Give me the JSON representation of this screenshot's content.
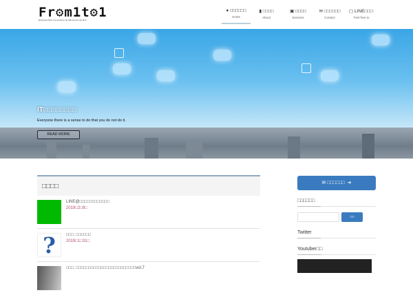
{
  "header": {
    "logo_text": "Fr⚙m1t⚙1",
    "logo_tagline": "Everyone there is a sense to do that you do not do it.",
    "nav": [
      {
        "label": "□□□□□□",
        "sub": "Home",
        "icon": "home-icon",
        "glyph": "●"
      },
      {
        "label": "□□□□",
        "sub": "About",
        "icon": "book-icon",
        "glyph": "▮"
      },
      {
        "label": "□□□□",
        "sub": "Services",
        "icon": "image-icon",
        "glyph": "▣"
      },
      {
        "label": "□□□□□□",
        "sub": "Contact",
        "icon": "envelope-icon",
        "glyph": "✉"
      },
      {
        "label": "LINE□□□:",
        "sub": "Feel free to",
        "icon": "chat-icon",
        "glyph": "▢"
      }
    ]
  },
  "hero": {
    "title": "IT□□□□□□□□",
    "subtitle": "Everyone there is a sense to do that you do not do it.",
    "button": "READ MORE"
  },
  "news": {
    "heading": "□□□□",
    "posts": [
      {
        "title": "LINE@□□□□□□□□□□□□",
        "date": "2019□2□8□",
        "thumb_color": "#00b900"
      },
      {
        "title": "□□□: □□□□□□",
        "date": "2019□1□31□",
        "thumb_color": "#ffffff"
      },
      {
        "title": "□□□: □□□□□□□□□□□□□□□□□□□□□□□□vol.7",
        "date": "",
        "thumb_color": "#777777"
      }
    ]
  },
  "sidebar": {
    "contact_button": "□□□□□□",
    "search_title": "□□□□□□",
    "search_button": "□□",
    "twitter_title": "Twitter",
    "youtube_title": "Youtuber□□"
  }
}
